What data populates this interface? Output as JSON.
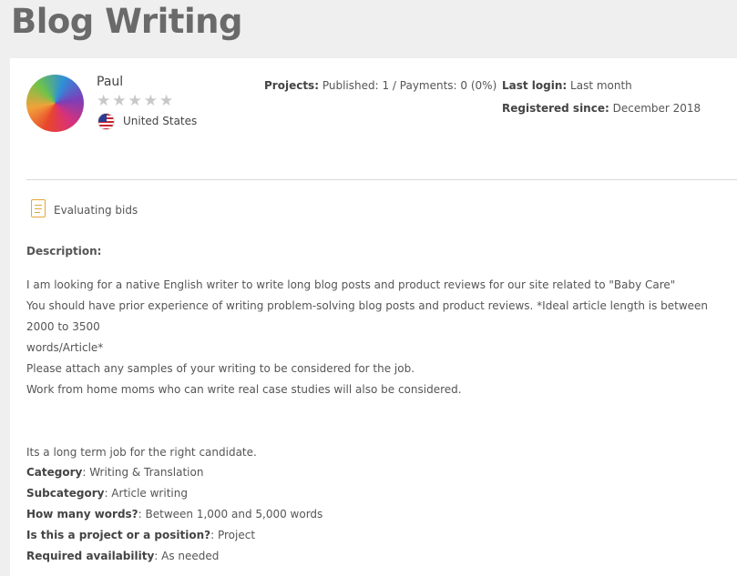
{
  "page": {
    "title": "Blog Writing"
  },
  "owner": {
    "name": "Paul",
    "rating_stars": 5,
    "rating_filled": 0,
    "country": "United States",
    "flag_icon": "us-flag-icon"
  },
  "projects": {
    "label": "Projects:",
    "value": "Published: 1 / Payments: 0 (0%)"
  },
  "last_login": {
    "label": "Last login:",
    "value": "Last month"
  },
  "registered": {
    "label": "Registered since:",
    "value": "December 2018"
  },
  "status": {
    "icon": "document-icon",
    "text": "Evaluating bids"
  },
  "description": {
    "label": "Description:",
    "lines": [
      "I am looking for a native English writer to write long blog posts and product reviews for our site related to \"Baby Care\"",
      "You should have prior experience of writing problem-solving blog posts and product reviews. *Ideal article length is between 2000 to 3500",
      "words/Article*",
      "Please attach any samples of your writing to be considered for the job.",
      "Work from home moms who can write real case studies will also be considered.",
      "",
      "",
      "Its a long term job for the right candidate."
    ]
  },
  "details": [
    {
      "label": "Category",
      "value": "Writing & Translation"
    },
    {
      "label": "Subcategory",
      "value": "Article writing"
    },
    {
      "label": "How many words?",
      "value": "Between 1,000 and 5,000 words"
    },
    {
      "label": "Is this a project or a position?",
      "value": "Project"
    },
    {
      "label": "Required availability",
      "value": "As needed"
    }
  ],
  "colors": {
    "status_icon": "#e3a73a",
    "star_empty": "#c8c8c8",
    "title": "#6a6a6a"
  }
}
